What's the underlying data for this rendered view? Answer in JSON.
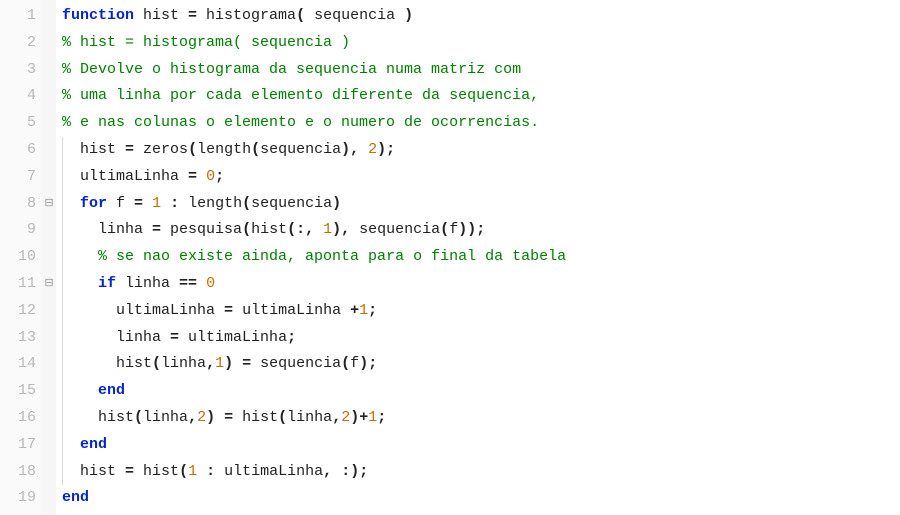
{
  "code": {
    "lines": [
      {
        "n": 1,
        "fold": "",
        "indent": 0,
        "bar": false,
        "tokens": [
          [
            "kw",
            "function"
          ],
          [
            "id",
            " hist "
          ],
          [
            "op bold",
            "="
          ],
          [
            "id",
            " histograma"
          ],
          [
            "op bold",
            "("
          ],
          [
            "id",
            " sequencia "
          ],
          [
            "op bold",
            ")"
          ]
        ]
      },
      {
        "n": 2,
        "fold": "",
        "indent": 0,
        "bar": false,
        "tokens": [
          [
            "cm",
            "% hist = histograma( sequencia )"
          ]
        ]
      },
      {
        "n": 3,
        "fold": "",
        "indent": 0,
        "bar": false,
        "tokens": [
          [
            "cm",
            "% Devolve o histograma da sequencia numa matriz com"
          ]
        ]
      },
      {
        "n": 4,
        "fold": "",
        "indent": 0,
        "bar": false,
        "tokens": [
          [
            "cm",
            "% uma linha por cada elemento diferente da sequencia,"
          ]
        ]
      },
      {
        "n": 5,
        "fold": "",
        "indent": 0,
        "bar": false,
        "tokens": [
          [
            "cm",
            "% e nas colunas o elemento e o numero de ocorrencias."
          ]
        ]
      },
      {
        "n": 6,
        "fold": "",
        "indent": 1,
        "bar": true,
        "tokens": [
          [
            "id",
            "hist "
          ],
          [
            "op bold",
            "="
          ],
          [
            "id",
            " zeros"
          ],
          [
            "op bold",
            "("
          ],
          [
            "id",
            "length"
          ],
          [
            "op bold",
            "("
          ],
          [
            "id",
            "sequencia"
          ],
          [
            "op bold",
            "),"
          ],
          [
            "id",
            " "
          ],
          [
            "num",
            "2"
          ],
          [
            "op bold",
            ");"
          ]
        ]
      },
      {
        "n": 7,
        "fold": "",
        "indent": 1,
        "bar": true,
        "tokens": [
          [
            "id",
            "ultimaLinha "
          ],
          [
            "op bold",
            "="
          ],
          [
            "id",
            " "
          ],
          [
            "num",
            "0"
          ],
          [
            "op bold",
            ";"
          ]
        ]
      },
      {
        "n": 8,
        "fold": "⊟",
        "indent": 1,
        "bar": true,
        "tokens": [
          [
            "kw",
            "for"
          ],
          [
            "id",
            " f "
          ],
          [
            "op bold",
            "="
          ],
          [
            "id",
            " "
          ],
          [
            "num",
            "1"
          ],
          [
            "id",
            " "
          ],
          [
            "op bold",
            ":"
          ],
          [
            "id",
            " length"
          ],
          [
            "op bold",
            "("
          ],
          [
            "id",
            "sequencia"
          ],
          [
            "op bold",
            ")"
          ]
        ]
      },
      {
        "n": 9,
        "fold": "",
        "indent": 2,
        "bar": true,
        "tokens": [
          [
            "id",
            "linha "
          ],
          [
            "op bold",
            "="
          ],
          [
            "id",
            " pesquisa"
          ],
          [
            "op bold",
            "("
          ],
          [
            "id",
            "hist"
          ],
          [
            "op bold",
            "(:,"
          ],
          [
            "id",
            " "
          ],
          [
            "num",
            "1"
          ],
          [
            "op bold",
            "),"
          ],
          [
            "id",
            " sequencia"
          ],
          [
            "op bold",
            "("
          ],
          [
            "id",
            "f"
          ],
          [
            "op bold",
            "));"
          ]
        ]
      },
      {
        "n": 10,
        "fold": "",
        "indent": 2,
        "bar": true,
        "tokens": [
          [
            "cm",
            "% se nao existe ainda, aponta para o final da tabela"
          ]
        ]
      },
      {
        "n": 11,
        "fold": "⊟",
        "indent": 2,
        "bar": true,
        "tokens": [
          [
            "kw",
            "if"
          ],
          [
            "id",
            " linha "
          ],
          [
            "op bold",
            "=="
          ],
          [
            "id",
            " "
          ],
          [
            "num",
            "0"
          ]
        ]
      },
      {
        "n": 12,
        "fold": "",
        "indent": 3,
        "bar": true,
        "tokens": [
          [
            "id",
            "ultimaLinha "
          ],
          [
            "op bold",
            "="
          ],
          [
            "id",
            " ultimaLinha "
          ],
          [
            "op bold",
            "+"
          ],
          [
            "num",
            "1"
          ],
          [
            "op bold",
            ";"
          ]
        ]
      },
      {
        "n": 13,
        "fold": "",
        "indent": 3,
        "bar": true,
        "tokens": [
          [
            "id",
            "linha "
          ],
          [
            "op bold",
            "="
          ],
          [
            "id",
            " ultimaLinha"
          ],
          [
            "op bold",
            ";"
          ]
        ]
      },
      {
        "n": 14,
        "fold": "",
        "indent": 3,
        "bar": true,
        "tokens": [
          [
            "id",
            "hist"
          ],
          [
            "op bold",
            "("
          ],
          [
            "id",
            "linha"
          ],
          [
            "op bold",
            ","
          ],
          [
            "num",
            "1"
          ],
          [
            "op bold",
            ")"
          ],
          [
            "id",
            " "
          ],
          [
            "op bold",
            "="
          ],
          [
            "id",
            " sequencia"
          ],
          [
            "op bold",
            "("
          ],
          [
            "id",
            "f"
          ],
          [
            "op bold",
            ");"
          ]
        ]
      },
      {
        "n": 15,
        "fold": "",
        "indent": 2,
        "bar": true,
        "tokens": [
          [
            "kw",
            "end"
          ]
        ]
      },
      {
        "n": 16,
        "fold": "",
        "indent": 2,
        "bar": true,
        "tokens": [
          [
            "id",
            "hist"
          ],
          [
            "op bold",
            "("
          ],
          [
            "id",
            "linha"
          ],
          [
            "op bold",
            ","
          ],
          [
            "num",
            "2"
          ],
          [
            "op bold",
            ")"
          ],
          [
            "id",
            " "
          ],
          [
            "op bold",
            "="
          ],
          [
            "id",
            " hist"
          ],
          [
            "op bold",
            "("
          ],
          [
            "id",
            "linha"
          ],
          [
            "op bold",
            ","
          ],
          [
            "num",
            "2"
          ],
          [
            "op bold",
            ")+"
          ],
          [
            "num",
            "1"
          ],
          [
            "op bold",
            ";"
          ]
        ]
      },
      {
        "n": 17,
        "fold": "",
        "indent": 1,
        "bar": true,
        "tokens": [
          [
            "kw",
            "end"
          ]
        ]
      },
      {
        "n": 18,
        "fold": "",
        "indent": 1,
        "bar": true,
        "tokens": [
          [
            "id",
            "hist "
          ],
          [
            "op bold",
            "="
          ],
          [
            "id",
            " hist"
          ],
          [
            "op bold",
            "("
          ],
          [
            "num",
            "1"
          ],
          [
            "id",
            " "
          ],
          [
            "op bold",
            ":"
          ],
          [
            "id",
            " ultimaLinha"
          ],
          [
            "op bold",
            ","
          ],
          [
            "id",
            " "
          ],
          [
            "op bold",
            ":);"
          ]
        ]
      },
      {
        "n": 19,
        "fold": "",
        "indent": 0,
        "bar": false,
        "tokens": [
          [
            "kw",
            "end"
          ]
        ]
      }
    ]
  },
  "indent_unit": "  "
}
